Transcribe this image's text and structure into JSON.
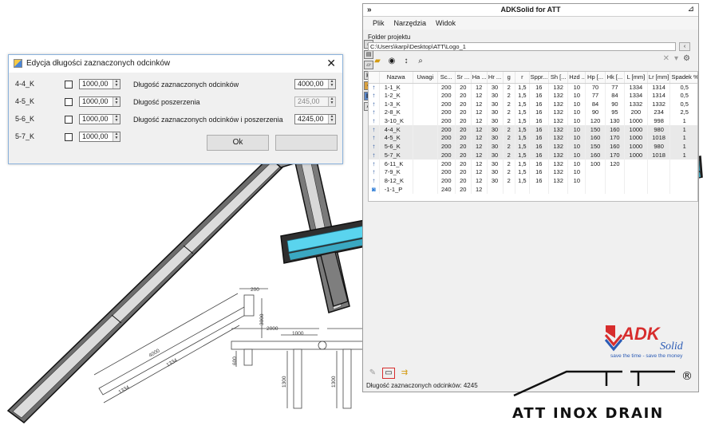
{
  "app": {
    "title": "ADKSolid for ATT",
    "menu": [
      "Plik",
      "Narzędzia",
      "Widok"
    ],
    "folder_label": "Folder projektu",
    "folder_path": "C:\\Users\\karpi\\Desktop\\ATT\\Logo_1",
    "status": "Długość zaznaczonych odcinków: 4245"
  },
  "grid": {
    "columns": [
      "",
      "Nazwa",
      "Uwagi",
      "Sc...",
      "Sr ...",
      "Ha ...",
      "Hr ...",
      "g",
      "r",
      "Sppr...",
      "Sh [...",
      "Hzd ...",
      "Hp [...",
      "Hk [...",
      "L [mm]",
      "Lr [mm]",
      "Spadek %"
    ],
    "rows": [
      [
        "1-1_K",
        "",
        "200",
        "20",
        "12",
        "30",
        "2",
        "1,5",
        "16",
        "132",
        "10",
        "70",
        "77",
        "1334",
        "1314",
        "0,5"
      ],
      [
        "1-2_K",
        "",
        "200",
        "20",
        "12",
        "30",
        "2",
        "1,5",
        "16",
        "132",
        "10",
        "77",
        "84",
        "1334",
        "1314",
        "0,5"
      ],
      [
        "1-3_K",
        "",
        "200",
        "20",
        "12",
        "30",
        "2",
        "1,5",
        "16",
        "132",
        "10",
        "84",
        "90",
        "1332",
        "1332",
        "0,5"
      ],
      [
        "2-8_K",
        "",
        "200",
        "20",
        "12",
        "30",
        "2",
        "1,5",
        "16",
        "132",
        "10",
        "90",
        "95",
        "200",
        "234",
        "2,5"
      ],
      [
        "3-10_K",
        "",
        "200",
        "20",
        "12",
        "30",
        "2",
        "1,5",
        "16",
        "132",
        "10",
        "120",
        "130",
        "1000",
        "998",
        "1"
      ],
      [
        "4-4_K",
        "",
        "200",
        "20",
        "12",
        "30",
        "2",
        "1,5",
        "16",
        "132",
        "10",
        "150",
        "160",
        "1000",
        "980",
        "1"
      ],
      [
        "4-5_K",
        "",
        "200",
        "20",
        "12",
        "30",
        "2",
        "1,5",
        "16",
        "132",
        "10",
        "160",
        "170",
        "1000",
        "1018",
        "1"
      ],
      [
        "5-6_K",
        "",
        "200",
        "20",
        "12",
        "30",
        "2",
        "1,5",
        "16",
        "132",
        "10",
        "150",
        "160",
        "1000",
        "980",
        "1"
      ],
      [
        "5-7_K",
        "",
        "200",
        "20",
        "12",
        "30",
        "2",
        "1,5",
        "16",
        "132",
        "10",
        "160",
        "170",
        "1000",
        "1018",
        "1"
      ],
      [
        "6-11_K",
        "",
        "200",
        "20",
        "12",
        "30",
        "2",
        "1,5",
        "16",
        "132",
        "10",
        "100",
        "120",
        "",
        "",
        ""
      ],
      [
        "7-9_K",
        "",
        "200",
        "20",
        "12",
        "30",
        "2",
        "1,5",
        "16",
        "132",
        "10",
        "",
        "",
        "",
        "",
        ""
      ],
      [
        "8-12_K",
        "",
        "200",
        "20",
        "12",
        "30",
        "2",
        "1,5",
        "16",
        "132",
        "10",
        "",
        "",
        "",
        "",
        ""
      ],
      [
        "-1-1_P",
        "",
        "240",
        "20",
        "12",
        "",
        "",
        "",
        "",
        "",
        "",
        "",
        "",
        "",
        "",
        ""
      ]
    ]
  },
  "dialog": {
    "title": "Edycja długości zaznaczonych odcinków",
    "rows": [
      {
        "label": "4-4_K",
        "value": "1000,00"
      },
      {
        "label": "4-5_K",
        "value": "1000,00"
      },
      {
        "label": "5-6_K",
        "value": "1000,00"
      },
      {
        "label": "5-7_K",
        "value": "1000,00"
      }
    ],
    "fields": [
      {
        "label": "Długość zaznaczonych odcinków",
        "value": "4000,00"
      },
      {
        "label": "Długość poszerzenia",
        "value": "245,00"
      },
      {
        "label": "Długość zaznaczonych odcinków i poszerzenia",
        "value": "4245,00"
      }
    ],
    "ok_label": "Ok"
  },
  "drawing": {
    "dims": [
      "200",
      "3000",
      "2000",
      "1000",
      "1000",
      "2000",
      "4000",
      "1334",
      "1334",
      "600",
      "1300",
      "1300"
    ]
  },
  "logos": {
    "adk_main": "ADK",
    "adk_sub": "Solid",
    "adk_tagline": "save the time - save the money",
    "att_text": "ATT INOX DRAIN",
    "registered": "®"
  },
  "colors": {
    "accent_blue": "#1f4e9c",
    "drain_cyan": "#5ad4ee",
    "adk_red": "#d72d2d",
    "adk_blue": "#2b5bb5"
  }
}
